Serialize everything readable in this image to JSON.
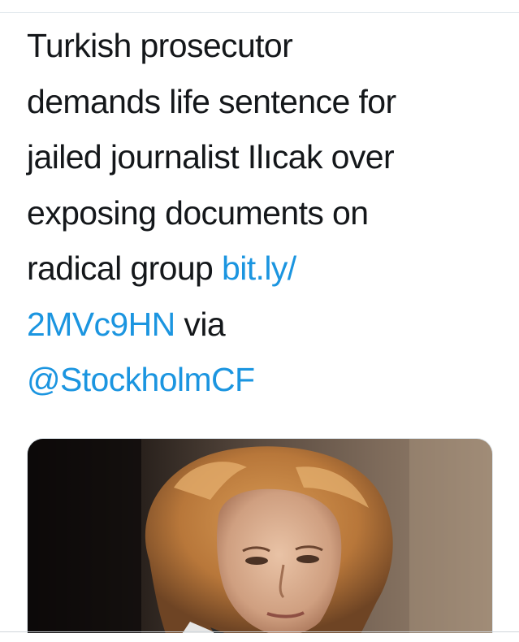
{
  "tweet": {
    "text_lines": [
      "Turkish prosecutor",
      "demands life sentence for",
      "jailed journalist Ilıcak over",
      "exposing documents on"
    ],
    "line5_text": "radical group ",
    "link_part1": "bit.ly/",
    "link_part2": "2MVc9HN",
    "via_text": " via",
    "mention": "@StockholmCF"
  },
  "media": {
    "description": "photo of a woman with curly blonde hair"
  },
  "colors": {
    "text": "#14171a",
    "link": "#1b95e0",
    "divider": "#e1e8ed"
  }
}
